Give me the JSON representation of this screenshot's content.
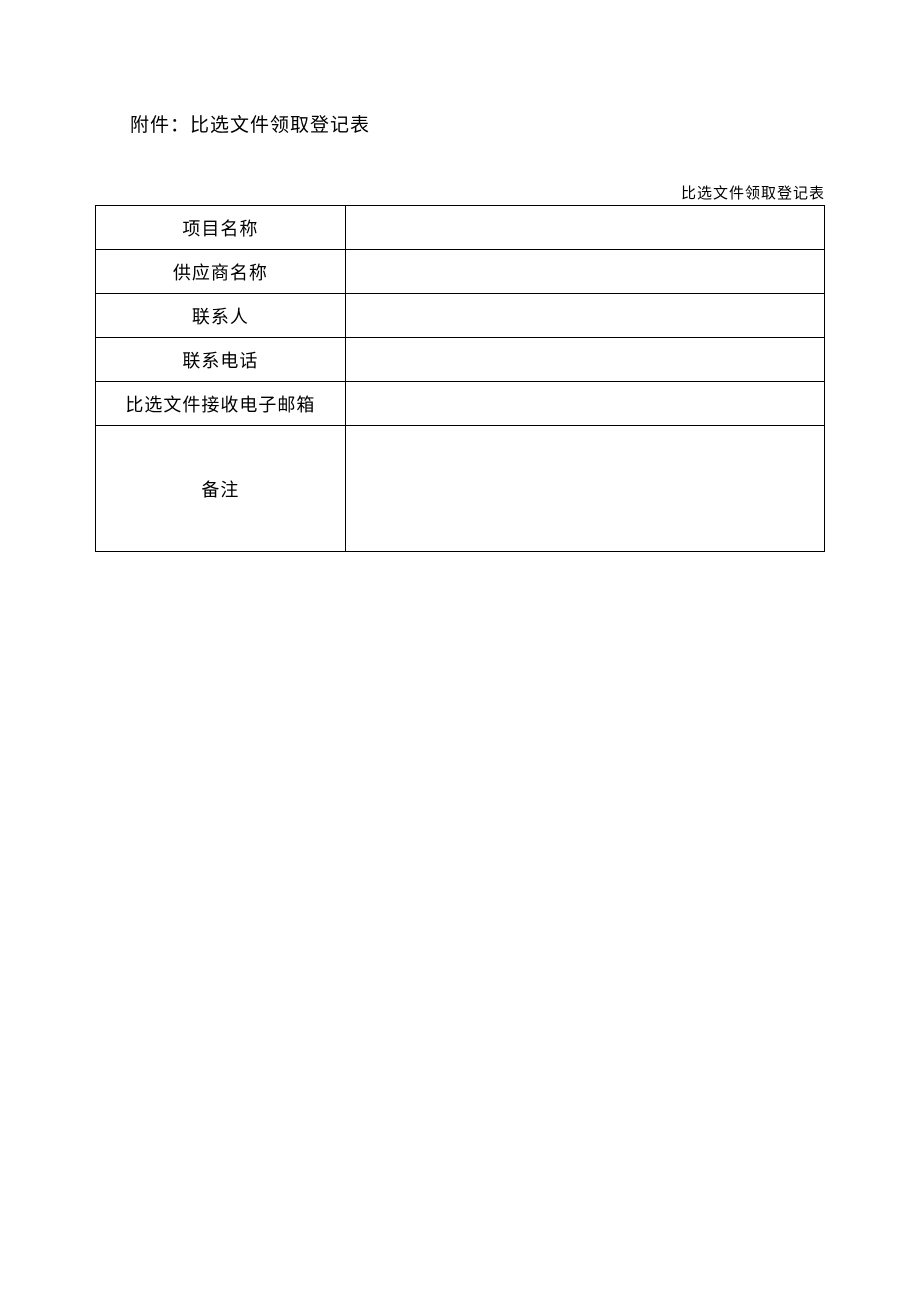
{
  "header": {
    "attachment_title": "附件：比选文件领取登记表",
    "table_caption": "比选文件领取登记表"
  },
  "rows": [
    {
      "label": "项目名称",
      "value": ""
    },
    {
      "label": "供应商名称",
      "value": ""
    },
    {
      "label": "联系人",
      "value": ""
    },
    {
      "label": "联系电话",
      "value": ""
    },
    {
      "label": "比选文件接收电子邮箱",
      "value": ""
    },
    {
      "label": "备注",
      "value": ""
    }
  ]
}
